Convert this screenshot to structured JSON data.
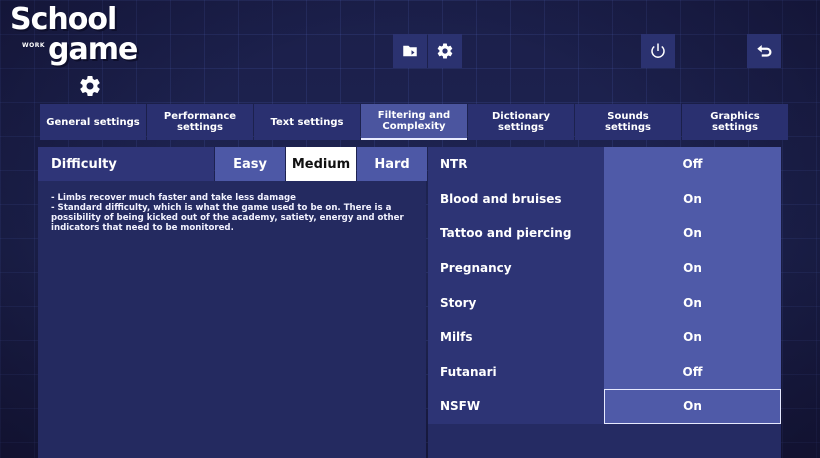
{
  "logo": {
    "line1": "School",
    "line2": "game",
    "sub": "WORK"
  },
  "top_icons": {
    "folder": "folder-icon",
    "settings": "gear-icon",
    "power": "power-icon",
    "back": "back-arrow-icon",
    "settings_large": "gear-icon"
  },
  "tabs": [
    {
      "label": "General settings",
      "active": false
    },
    {
      "label": "Performance settings",
      "active": false
    },
    {
      "label": "Text settings",
      "active": false
    },
    {
      "label": "Filtering and\nComplexity",
      "active": true
    },
    {
      "label": "Dictionary\nsettings",
      "active": false
    },
    {
      "label": "Sounds\nsettings",
      "active": false
    },
    {
      "label": "Graphics\nsettings",
      "active": false
    }
  ],
  "difficulty": {
    "label": "Difficulty",
    "options": [
      "Easy",
      "Medium",
      "Hard"
    ],
    "selected": "Medium",
    "description": "- Limbs recover much faster and take less damage\n- Standard difficulty, which is what the game used to be on. There is a possibility of being kicked out of the academy, satiety, energy and other indicators that need to be monitored."
  },
  "options": [
    {
      "label": "NTR",
      "value": "Off"
    },
    {
      "label": "Blood and bruises",
      "value": "On"
    },
    {
      "label": "Tattoo and piercing",
      "value": "On"
    },
    {
      "label": "Pregnancy",
      "value": "On"
    },
    {
      "label": "Story",
      "value": "On"
    },
    {
      "label": "Milfs",
      "value": "On"
    },
    {
      "label": "Futanari",
      "value": "Off"
    },
    {
      "label": "NSFW",
      "value": "On"
    }
  ],
  "colors": {
    "background": "#1b1f4a",
    "panel": "#2d3475",
    "value_cell": "#4f5aa8",
    "selected": "#ffffff"
  }
}
